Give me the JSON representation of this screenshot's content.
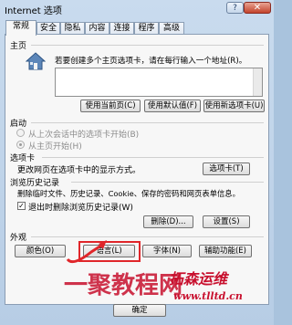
{
  "window": {
    "title": "Internet 选项",
    "help_button": "?",
    "close_button": "✕"
  },
  "tabs": [
    "常规",
    "安全",
    "隐私",
    "内容",
    "连接",
    "程序",
    "高级"
  ],
  "homepage": {
    "heading": "主页",
    "description_line1": "若要创建多个主页选项卡，请在每行输入一个地址(R)。",
    "url": "",
    "btn_current": "使用当前页(C)",
    "btn_default": "使用默认值(F)",
    "btn_blank": "使用新选项卡(U)"
  },
  "startup": {
    "heading": "启动",
    "option1": "从上次会话中的选项卡开始(B)",
    "option2": "从主页开始(H)"
  },
  "tabs_section": {
    "heading": "选项卡",
    "description": "更改网页在选项卡中的显示方式。",
    "button": "选项卡(T)"
  },
  "history": {
    "heading": "浏览历史记录",
    "description": "删除临时文件、历史记录、Cookie、保存的密码和网页表单信息。",
    "checkbox_label": "退出时删除浏览历史记录(W)",
    "btn_delete": "删除(D)...",
    "btn_settings": "设置(S)"
  },
  "appearance": {
    "heading": "外观",
    "btn_colors": "颜色(O)",
    "btn_languages": "语言(L)",
    "btn_fonts": "字体(N)",
    "btn_accessibility": "辅助功能(E)"
  },
  "footer": {
    "btn_ok": "确定"
  },
  "watermark": {
    "line1": "一聚教程网",
    "line2": "www.tlltd.cn",
    "line3": "拓森运维"
  },
  "colors": {
    "highlight": "#e0262a",
    "watermark": "#c8102e"
  }
}
